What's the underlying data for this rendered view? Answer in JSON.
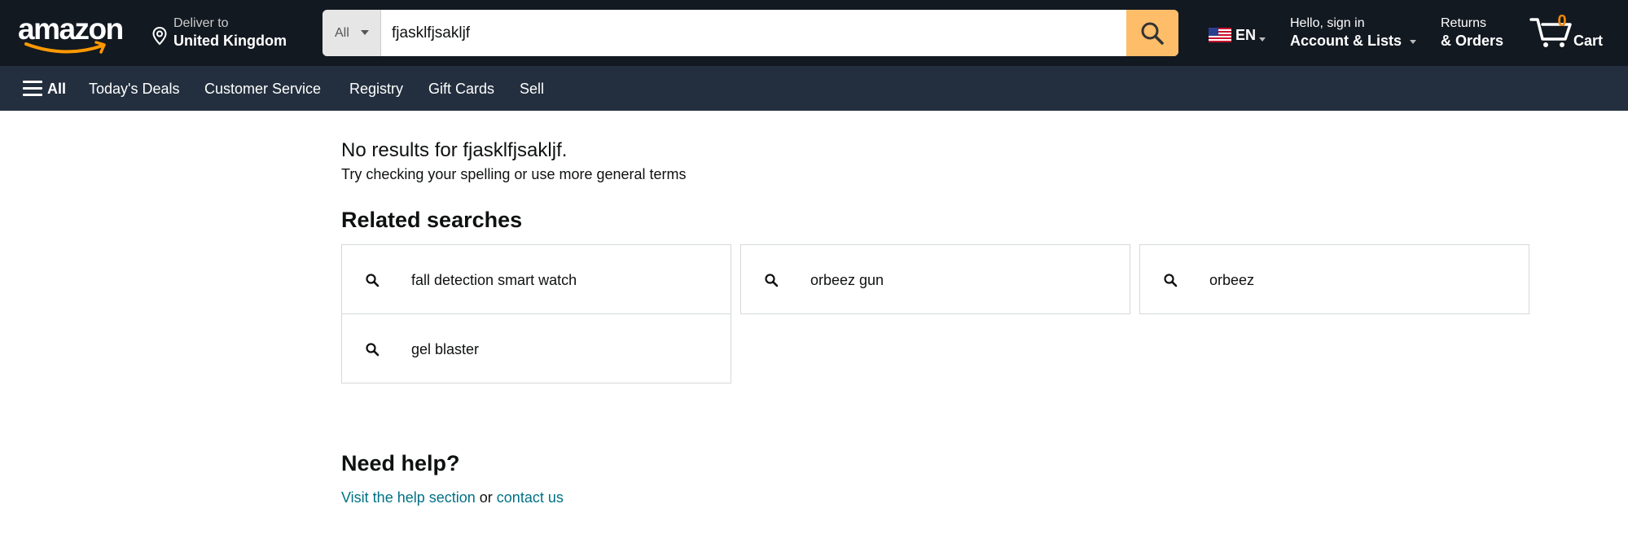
{
  "header": {
    "logo_text": "amazon",
    "deliver_to_label": "Deliver to",
    "deliver_to_location": "United Kingdom",
    "search": {
      "category": "All",
      "query": "fjasklfjsakljf"
    },
    "language": "EN",
    "account_greeting": "Hello, sign in",
    "account_label": "Account & Lists",
    "returns_label": "Returns",
    "orders_label": "& Orders",
    "cart_count": "0",
    "cart_label": "Cart"
  },
  "subnav": {
    "all_label": "All",
    "items": [
      "Today's Deals",
      "Customer Service",
      "Registry",
      "Gift Cards",
      "Sell"
    ]
  },
  "results": {
    "no_results_text": "No results for fjasklfjsakljf.",
    "hint": "Try checking your spelling or use more general terms"
  },
  "related": {
    "title": "Related searches",
    "items": [
      "fall detection smart watch",
      "orbeez gun",
      "orbeez",
      "gel blaster"
    ]
  },
  "help": {
    "title": "Need help?",
    "link1": "Visit the help section",
    "connector": " or ",
    "link2": "contact us"
  },
  "colors": {
    "nav_top_bg": "#131921",
    "nav_sub_bg": "#232f3e",
    "search_button": "#febd69",
    "cart_count": "#f08804",
    "link": "#007185"
  }
}
